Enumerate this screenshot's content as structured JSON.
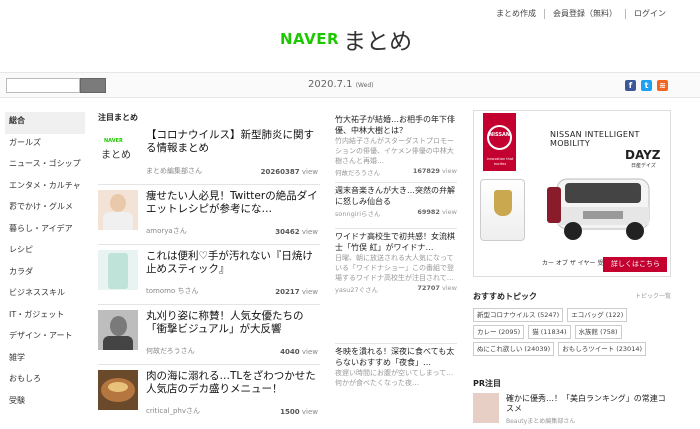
{
  "header": {
    "links": [
      "まとめ作成",
      "会員登録（無料）",
      "ログイン"
    ],
    "logo_naver": "NAVER",
    "logo_matome": "まとめ",
    "date": "2020.7.1",
    "weekday": "(Wed)"
  },
  "sidebar": {
    "items": [
      "総合",
      "ガールズ",
      "ニュース・ゴシップ",
      "エンタメ・カルチャー",
      "おでかけ・グルメ",
      "暮らし・アイデア",
      "レシピ",
      "カラダ",
      "ビジネススキル",
      "IT・ガジェット",
      "デザイン・アート",
      "雑学",
      "おもしろ",
      "受験"
    ]
  },
  "main": {
    "section_title": "注目まとめ",
    "articles": [
      {
        "title": "【コロナウイルス】新型肺炎に関する情報まとめ",
        "author": "まとめ編集部さん",
        "views": "20260387",
        "unit": "view"
      },
      {
        "title": "痩せたい人必見！Twitterの絶品ダイエットレシピが参考にな…",
        "author": "amoryaさん",
        "views": "30462",
        "unit": "view"
      },
      {
        "title": "これは便利♡手が汚れない『日焼け止めスティック』",
        "author": "tomomo ちさん",
        "views": "20217",
        "unit": "view"
      },
      {
        "title": "丸刈り姿に称賛！人気女優たちの「衝撃ビジュアル」が大反響",
        "author": "何故だろうさん",
        "views": "4040",
        "unit": "view"
      },
      {
        "title": "肉の海に溺れる…TLをざわつかせた人気店のデカ盛りメニュー！",
        "author": "critical_phvさん",
        "views": "1500",
        "unit": "view"
      }
    ]
  },
  "middle": {
    "articles": [
      {
        "title": "竹大祐子が結婚…お相手の年下俳優、中林大樹とは？",
        "desc": "竹内結子さんがスターダストプロモーションの俳優、イケメン俳優の中林大樹さんと再婚…",
        "author": "何故だろうさん",
        "views": "167829",
        "unit": "view"
      },
      {
        "title": "週末音楽きんが大き…突然の弁解に怒しみ仙台る",
        "desc": "",
        "author": "sonngiriらさん",
        "views": "69982",
        "unit": "view"
      },
      {
        "title": "ワイドナ高校生で初共感！女流棋士「竹俣 紅」がワイドナ…",
        "desc": "日曜、朝に放送される大人気になっている「ワイドナショー」この番組で登場するワイドナ高校生が注目されて…",
        "author": "yasu27ぐさん",
        "views": "72707",
        "unit": "view"
      },
      {
        "title": "冬映を潰れる！深夜に食べても太らないおすすめ「夜食」…",
        "desc": "夜遅い時間にお腹が空いてしまって…何かが食べたくなった夜…",
        "author": "",
        "views": "",
        "unit": ""
      }
    ]
  },
  "ad": {
    "brand": "NISSAN INTELLIGENT MOBILITY",
    "model": "DAYZ",
    "model_sub": "日産デイズ",
    "emblem": "NISSAN",
    "caption": "innovation that excites",
    "bottom_text": "カー オブ ザ イヤー 受賞",
    "cta": "詳しくはこちら"
  },
  "topics": {
    "title": "おすすめトピック",
    "more": "トピック一覧",
    "items": [
      "新型コロナウイルス (5247)",
      "エコバッグ (122)",
      "カレー (2095)",
      "猫 (11834)",
      "水族館 (758)",
      "ぬにこれ欲しい (24039)",
      "おもしろツイート (23014)"
    ]
  },
  "pr": {
    "title": "PR注目",
    "item_title": "確かに優秀…！「美白ランキング」の常連コスメ",
    "item_author": "Beautyまとめ編集部さん"
  },
  "colors": {
    "naver_green": "#1ec800",
    "nissan_red": "#c3002f"
  }
}
